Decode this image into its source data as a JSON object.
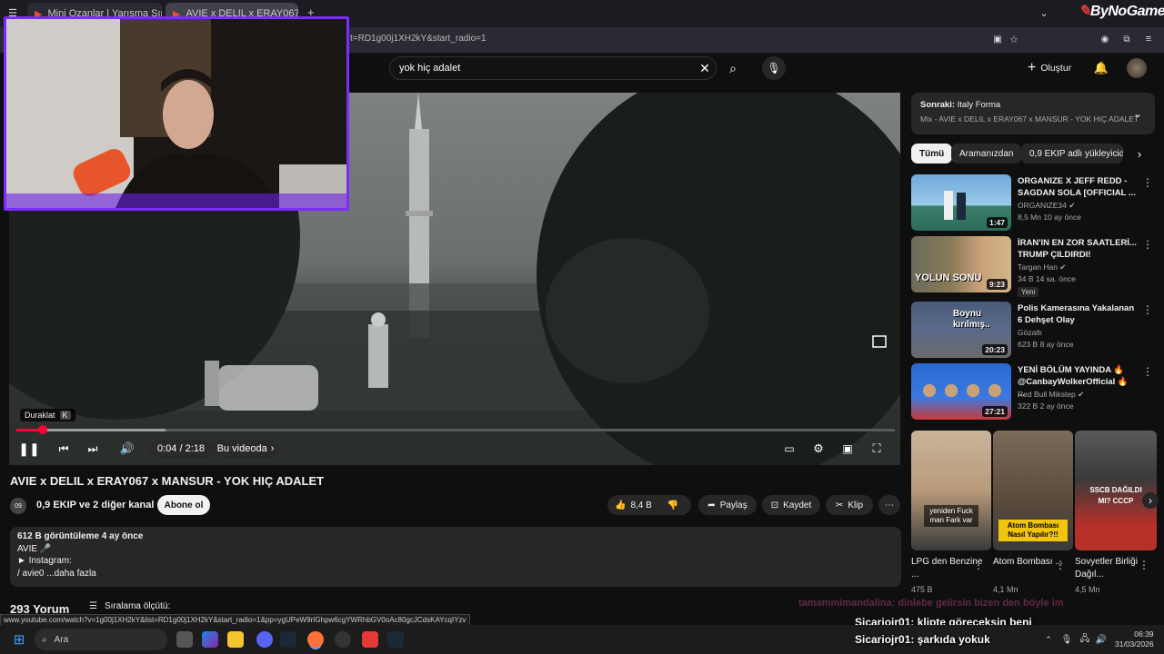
{
  "browser": {
    "tabs": [
      {
        "label": "Mini Ozanlar | Yarışma Sıralı"
      },
      {
        "label": "AVIE x DELIL x ERAY067 x M"
      }
    ],
    "url_fragment": "t=RD1g00j1XH2kY&start_radio=1",
    "new_tab": "+",
    "watermark": "ByNoGame"
  },
  "youtube": {
    "search_value": "yok hiç adalet",
    "create_label": "Oluştur",
    "player": {
      "pause_tooltip": "Duraklat",
      "pause_key": "K",
      "time": "0:04 / 2:18",
      "in_video": "Bu videoda",
      "progress": 0.03,
      "buffer": 0.17
    },
    "title": "AVIE x DELIL x ERAY067 x MANSUR - YOK HIÇ ADALET",
    "channel": "0,9 EKIP ve 2 diğer kanal",
    "subscribe": "Abone ol",
    "actions": {
      "likes": "8,4 B",
      "share": "Paylaş",
      "save": "Kaydet",
      "clip": "Klip"
    },
    "description": {
      "stats": "612 B görüntüleme  4 ay önce",
      "line1": "AVIE 🎤",
      "line2": "► Instagram:",
      "line3": "/ avie0   ...daha fazla"
    },
    "comments": {
      "count": "293 Yorum",
      "sort": "Sıralama ölçütü:"
    },
    "sidebar": {
      "next_prefix": "Sonraki:",
      "next_title": "Italy Forma",
      "next_sub": "Mix - AVIE x DELIL x ERAY067 x MANSUR - YOK HIÇ ADALET",
      "chips": [
        "Tümü",
        "Aramanızdan",
        "0,9 EKIP adlı yükleyiciden"
      ],
      "videos": [
        {
          "title": "ORGANIZE X JEFF REDD - SAGDAN SOLA [OFFICIAL ...",
          "channel": "ORGANIZE34 ✔",
          "meta": "8,5 Mn  10 ay önce",
          "duration": "1:47",
          "badge": ""
        },
        {
          "title": "İRAN'IN EN ZOR SAATLERİ... TRUMP ÇILDIRDI!",
          "channel": "Targan Han ✔",
          "meta": "34 B  14 sa. önce",
          "duration": "9:23",
          "badge": "Yeni",
          "thumb_text": "YOLUN SONU"
        },
        {
          "title": "Polis Kamerasına Yakalanan 6 Dehşet Olay",
          "channel": "Gözaltı",
          "meta": "623 B  8 ay önce",
          "duration": "20:23",
          "badge": "",
          "thumb_text": "Boynu kırılmış.."
        },
        {
          "title": "YENİ BÖLÜM YAYINDA 🔥 @CanbayWolkerOfficial 🔥 ...",
          "channel": "Red Bull Mikstep ✔",
          "meta": "322 B  2 ay önce",
          "duration": "27:21",
          "badge": ""
        }
      ],
      "shorts": [
        {
          "title": "LPG den Benzine ...",
          "views": "475 B",
          "thumb_text": "yeniden Fuck man Fark var"
        },
        {
          "title": "Atom Bombası ...",
          "views": "4,1 Mn",
          "thumb_text": "Atom Bombası Nasıl Yapılır?!!"
        },
        {
          "title": "Sovyetler Birliği Dağıl...",
          "views": "4,5 Mn",
          "thumb_text": "SSCB DAĞILDI MI? СССР"
        }
      ]
    }
  },
  "status_url": "www.youtube.com/watch?v=1g00j1XH2kY&list=RD1g00j1XH2kY&start_radio=1&pp=ygUPeW9rIGhpw6cgYWRhbGV0oAc80gcJCdsKAYcqIYzv",
  "stream_overlay": {
    "chat_faded": "tamammimandalina: dinlebe gelirsin bizen den böyle im",
    "chat1_user": "Sicariojr01:",
    "chat1_msg": "klipte göreceksin beni",
    "chat2_user": "Sicariojr01:",
    "chat2_msg": "şarkıda yokuk"
  },
  "taskbar": {
    "search": "Ara",
    "time": "06:39",
    "date": "31/03/2026"
  }
}
